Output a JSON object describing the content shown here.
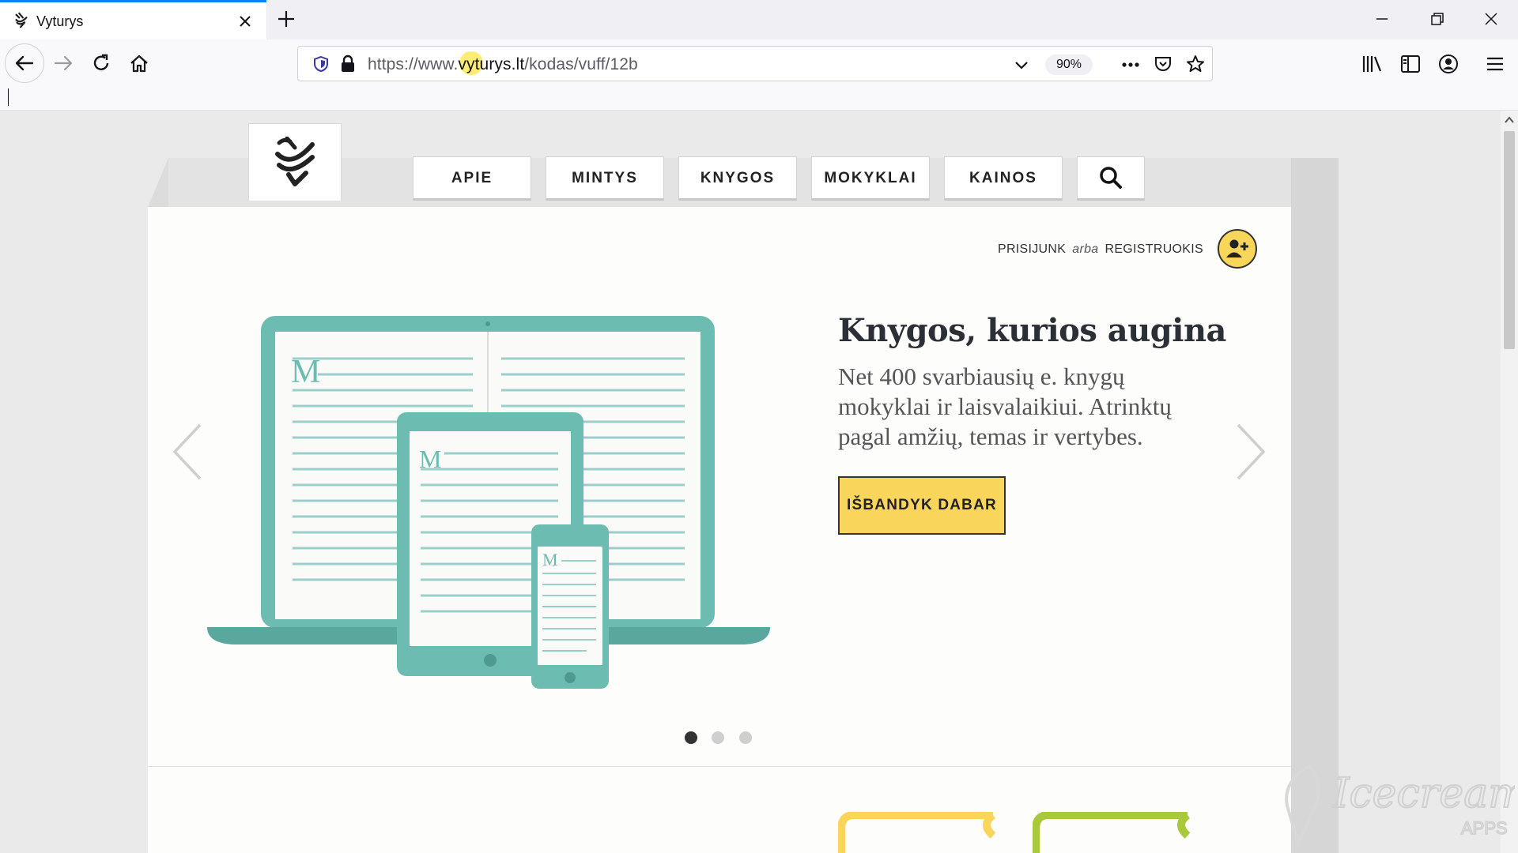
{
  "browser": {
    "tab_title": "Vyturys",
    "url_prefix": "https://www.",
    "url_host": "vyturys.lt",
    "url_path": "/kodas/vuff/12b",
    "zoom": "90%"
  },
  "site": {
    "nav": {
      "items": [
        {
          "label": "APIE"
        },
        {
          "label": "MINTYS"
        },
        {
          "label": "KNYGOS"
        },
        {
          "label": "MOKYKLAI"
        },
        {
          "label": "KAINOS"
        }
      ]
    },
    "auth": {
      "login": "PRISIJUNK",
      "or": "arba",
      "register": "REGISTRUOKIS"
    },
    "hero": {
      "title": "Knygos, kurios augina",
      "subtitle": "Net 400 svarbiausių e. knygų mokyklai ir laisvalaikiui. Atrinktų pagal amžių, temas ir vertybes.",
      "cta": "IŠBANDYK DABAR"
    },
    "carousel": {
      "slide_count": 3,
      "active_index": 0
    },
    "colors": {
      "accent_yellow": "#f9d65b",
      "teal": "#6bbfb4",
      "lime": "#a8c93a"
    }
  },
  "watermark": {
    "text": "Icecream",
    "sub": "APPS"
  }
}
